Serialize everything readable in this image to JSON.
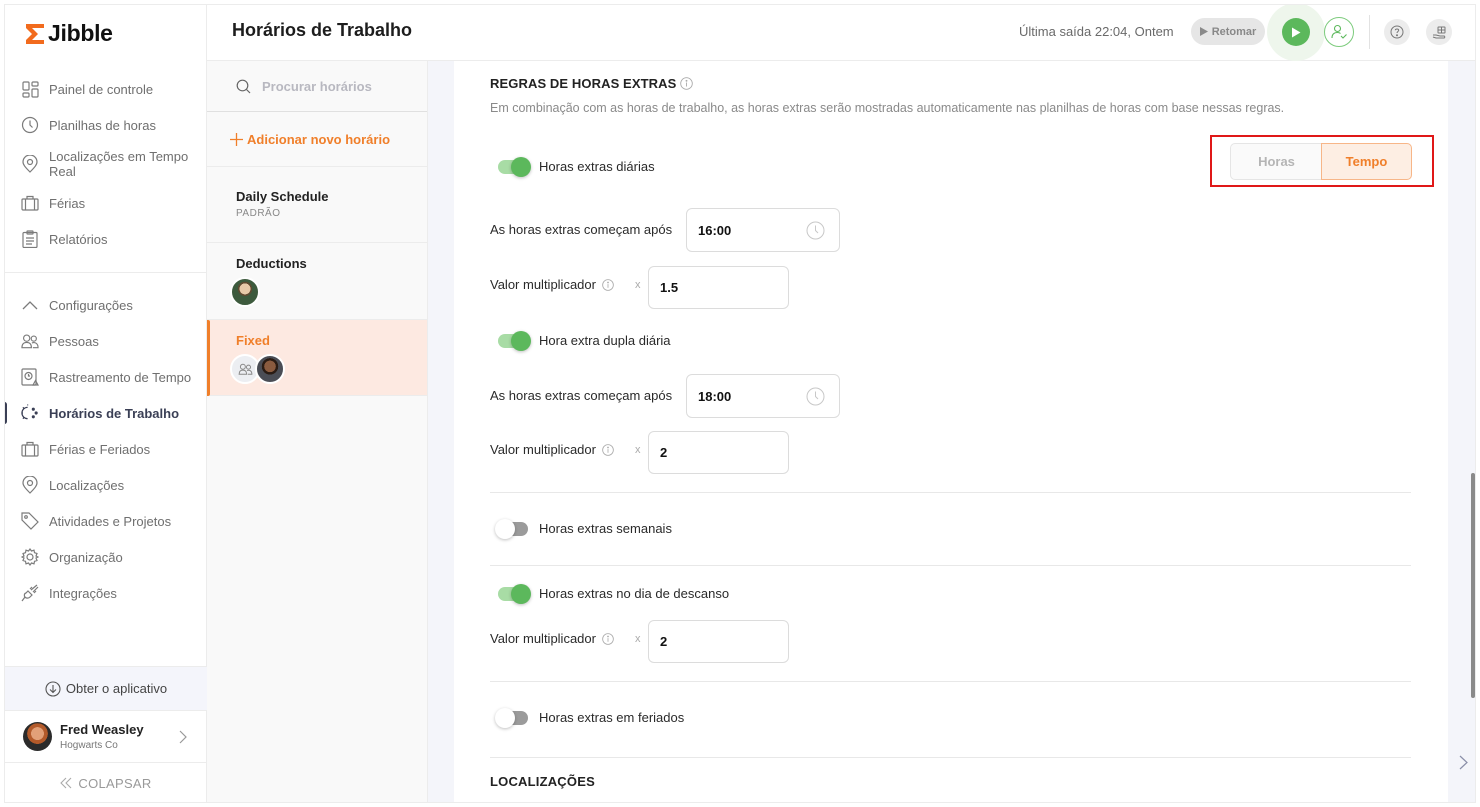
{
  "app": {
    "brand": "Jibble",
    "brand_color": "#f26b1d",
    "accent_color": "#f07f2a",
    "success_color": "#5cb85c"
  },
  "sidebar": {
    "main_items": [
      {
        "label": "Painel de controle",
        "icon": "dashboard-icon"
      },
      {
        "label": "Planilhas de horas",
        "icon": "clock-icon"
      },
      {
        "label": "Localizações em Tempo Real",
        "icon": "location-pin-icon"
      },
      {
        "label": "Férias",
        "icon": "suitcase-icon"
      },
      {
        "label": "Relatórios",
        "icon": "clipboard-icon"
      }
    ],
    "settings_group": {
      "label": "Configurações",
      "icon": "chevron-up-icon",
      "expanded": true
    },
    "settings_items": [
      {
        "label": "Pessoas",
        "icon": "people-icon",
        "active": false
      },
      {
        "label": "Rastreamento de Tempo",
        "icon": "time-tracking-icon",
        "active": false
      },
      {
        "label": "Horários de Trabalho",
        "icon": "work-schedule-icon",
        "active": true
      },
      {
        "label": "Férias e Feriados",
        "icon": "suitcase-icon",
        "active": false
      },
      {
        "label": "Localizações",
        "icon": "location-pin-icon",
        "active": false
      },
      {
        "label": "Atividades e Projetos",
        "icon": "tag-icon",
        "active": false
      },
      {
        "label": "Organização",
        "icon": "gear-icon",
        "active": false
      },
      {
        "label": "Integrações",
        "icon": "plug-icon",
        "active": false
      }
    ],
    "get_app": "Obter o aplicativo",
    "user": {
      "name": "Fred Weasley",
      "org": "Hogwarts Co"
    },
    "collapse": "COLAPSAR"
  },
  "header": {
    "title": "Horários de Trabalho",
    "last_out": "Última saída 22:04, Ontem",
    "resume_label": "Retomar"
  },
  "schedules": {
    "search_placeholder": "Procurar horários",
    "add_label": "Adicionar novo horário",
    "items": [
      {
        "name": "Daily Schedule",
        "subtitle": "PADRÃO",
        "selected": false
      },
      {
        "name": "Deductions",
        "members": 1,
        "selected": false
      },
      {
        "name": "Fixed",
        "members": 1,
        "group": true,
        "selected": true
      }
    ]
  },
  "overtime": {
    "title": "REGRAS DE HORAS EXTRAS",
    "description": "Em combinação com as horas de trabalho, as horas extras serão mostradas automaticamente nas planilhas de horas com base nessas regras.",
    "mode_options": [
      "Horas",
      "Tempo"
    ],
    "mode_selected": "Tempo",
    "daily": {
      "label": "Horas extras diárias",
      "enabled": true,
      "start_label": "As horas extras começam após",
      "start_value": "16:00",
      "multiplier_label": "Valor multiplicador",
      "multiplier_prefix": "x",
      "multiplier_value": "1.5"
    },
    "daily_double": {
      "label": "Hora extra dupla diária",
      "enabled": true,
      "start_label": "As horas extras começam após",
      "start_value": "18:00",
      "multiplier_label": "Valor multiplicador",
      "multiplier_prefix": "x",
      "multiplier_value": "2"
    },
    "weekly": {
      "label": "Horas extras semanais",
      "enabled": false
    },
    "rest_day": {
      "label": "Horas extras no dia de descanso",
      "enabled": true,
      "multiplier_label": "Valor multiplicador",
      "multiplier_prefix": "x",
      "multiplier_value": "2"
    },
    "holiday": {
      "label": "Horas extras em feriados",
      "enabled": false
    }
  },
  "locations": {
    "title": "LOCALIZAÇÕES"
  }
}
